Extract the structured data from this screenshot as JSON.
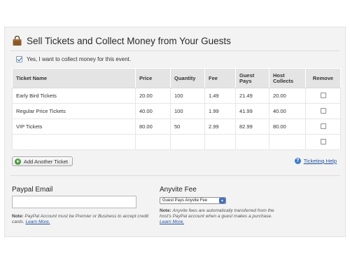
{
  "header": {
    "title": "Sell Tickets and Collect Money from Your Guests",
    "icon": "shopping-bag-icon"
  },
  "optin": {
    "label": "Yes, I want to collect money for this event.",
    "checked": true
  },
  "table": {
    "columns": [
      "Ticket Name",
      "Price",
      "Quantity",
      "Fee",
      "Guest Pays",
      "Host Collects",
      "Remove"
    ],
    "rows": [
      {
        "name": "Early Bird Tickets",
        "price": "20.00",
        "quantity": "100",
        "fee": "1.49",
        "guest_pays": "21.49",
        "host_collects": "20.00"
      },
      {
        "name": "Regular Price Tickets",
        "price": "40.00",
        "quantity": "100",
        "fee": "1.99",
        "guest_pays": "41.99",
        "host_collects": "40.00"
      },
      {
        "name": "VIP Tickets",
        "price": "80.00",
        "quantity": "50",
        "fee": "2.99",
        "guest_pays": "82.99",
        "host_collects": "80.00"
      },
      {
        "name": "",
        "price": "",
        "quantity": "",
        "fee": "",
        "guest_pays": "",
        "host_collects": ""
      }
    ]
  },
  "actions": {
    "add_ticket": "Add Another Ticket",
    "help_link": "Ticketing Help"
  },
  "paypal": {
    "label": "Paypal Email",
    "value": "",
    "note_label": "Note:",
    "note_text": "PayPal Account must be Premier or Business to accept credit cards.",
    "note_link": "Learn More."
  },
  "fee": {
    "label": "Anyvite Fee",
    "selected": "Guest Pays Anyvite Fee",
    "note_label": "Note:",
    "note_text": "Anyvite fees are automatically transferred from the host's PayPal account when a guest makes a purchase.",
    "note_link": "Learn More."
  },
  "colors": {
    "header_bg": "#e4e4e4",
    "panel_bg": "#f3f3f3",
    "link": "#1f4f9c",
    "add_icon": "#4a9a3e",
    "help_icon": "#3c7dc4"
  }
}
